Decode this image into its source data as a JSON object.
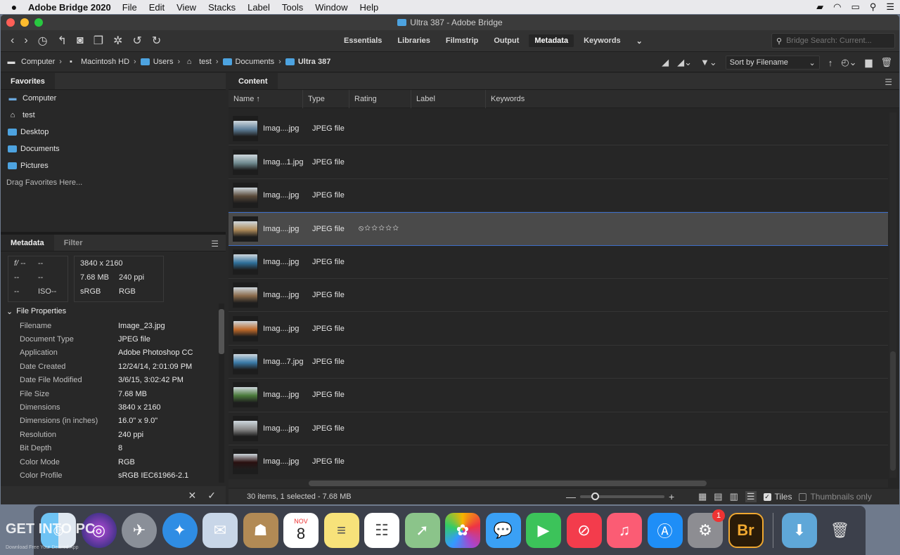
{
  "menubar": {
    "app_name": "Adobe Bridge 2020",
    "menus": [
      "File",
      "Edit",
      "View",
      "Stacks",
      "Label",
      "Tools",
      "Window",
      "Help"
    ]
  },
  "window": {
    "title": "Ultra 387 - Adobe Bridge"
  },
  "toolbar": {
    "workspaces": [
      "Essentials",
      "Libraries",
      "Filmstrip",
      "Output",
      "Metadata",
      "Keywords"
    ],
    "active_workspace": "Metadata",
    "search_placeholder": "Bridge Search: Current..."
  },
  "path": {
    "crumbs": [
      "Computer",
      "Macintosh HD",
      "Users",
      "test",
      "Documents",
      "Ultra 387"
    ],
    "sort_label": "Sort by Filename"
  },
  "favorites": {
    "tab": "Favorites",
    "items": [
      "Computer",
      "test",
      "Desktop",
      "Documents",
      "Pictures"
    ],
    "drag_hint": "Drag Favorites Here..."
  },
  "metadata_panel": {
    "tabs": [
      "Metadata",
      "Filter"
    ],
    "camera": {
      "fstop_label": "f/",
      "fstop": "--",
      "shutter": "--",
      "c1": "--",
      "c2": "--",
      "c3": "--",
      "iso_label": "ISO",
      "iso": "--"
    },
    "image": {
      "dimensions": "3840 x 2160",
      "size": "7.68 MB",
      "resolution": "240 ppi",
      "profile": "sRGB",
      "mode": "RGB"
    },
    "section": "File Properties",
    "props": [
      {
        "key": "Filename",
        "value": "Image_23.jpg"
      },
      {
        "key": "Document Type",
        "value": "JPEG file"
      },
      {
        "key": "Application",
        "value": "Adobe Photoshop CC"
      },
      {
        "key": "Date Created",
        "value": "12/24/14, 2:01:09 PM"
      },
      {
        "key": "Date File Modified",
        "value": "3/6/15, 3:02:42 PM"
      },
      {
        "key": "File Size",
        "value": "7.68 MB"
      },
      {
        "key": "Dimensions",
        "value": "3840 x 2160"
      },
      {
        "key": "Dimensions (in inches)",
        "value": "16.0\" x 9.0\""
      },
      {
        "key": "Resolution",
        "value": "240 ppi"
      },
      {
        "key": "Bit Depth",
        "value": "8"
      },
      {
        "key": "Color Mode",
        "value": "RGB"
      },
      {
        "key": "Color Profile",
        "value": "sRGB IEC61966-2.1"
      }
    ]
  },
  "content": {
    "tab": "Content",
    "columns": [
      "Name",
      "Type",
      "Rating",
      "Label",
      "Keywords"
    ],
    "rows": [
      {
        "name": "Imag....jpg",
        "type": "JPEG file",
        "rating": "",
        "thumb_color": "#5f7f9a"
      },
      {
        "name": "Imag...1.jpg",
        "type": "JPEG file",
        "rating": "",
        "thumb_color": "#6f8a8f"
      },
      {
        "name": "Imag....jpg",
        "type": "JPEG file",
        "rating": "",
        "thumb_color": "#5a4a3a"
      },
      {
        "name": "Imag....jpg",
        "type": "JPEG file",
        "rating": "⦸☆☆☆☆☆",
        "thumb_color": "#b08c5a",
        "selected": true
      },
      {
        "name": "Imag....jpg",
        "type": "JPEG file",
        "rating": "",
        "thumb_color": "#2f6f9a"
      },
      {
        "name": "Imag....jpg",
        "type": "JPEG file",
        "rating": "",
        "thumb_color": "#8a6a4a"
      },
      {
        "name": "Imag....jpg",
        "type": "JPEG file",
        "rating": "",
        "thumb_color": "#c06a2a"
      },
      {
        "name": "Imag...7.jpg",
        "type": "JPEG file",
        "rating": "",
        "thumb_color": "#3a7aa8"
      },
      {
        "name": "Imag....jpg",
        "type": "JPEG file",
        "rating": "",
        "thumb_color": "#4a7a3a"
      },
      {
        "name": "Imag....jpg",
        "type": "JPEG file",
        "rating": "",
        "thumb_color": "#8a8a8a"
      },
      {
        "name": "Imag....jpg",
        "type": "JPEG file",
        "rating": "",
        "thumb_color": "#2a1010"
      }
    ],
    "status": "30 items, 1 selected - 7.68 MB",
    "tiles_label": "Tiles",
    "thumbnails_only_label": "Thumbnails only"
  },
  "dock": {
    "calendar_month": "NOV",
    "calendar_day": "8",
    "settings_badge": "1",
    "bridge_label": "Br"
  },
  "watermark": {
    "text": "GET INTO PC",
    "subtext": "Download Free Your Desired App"
  }
}
